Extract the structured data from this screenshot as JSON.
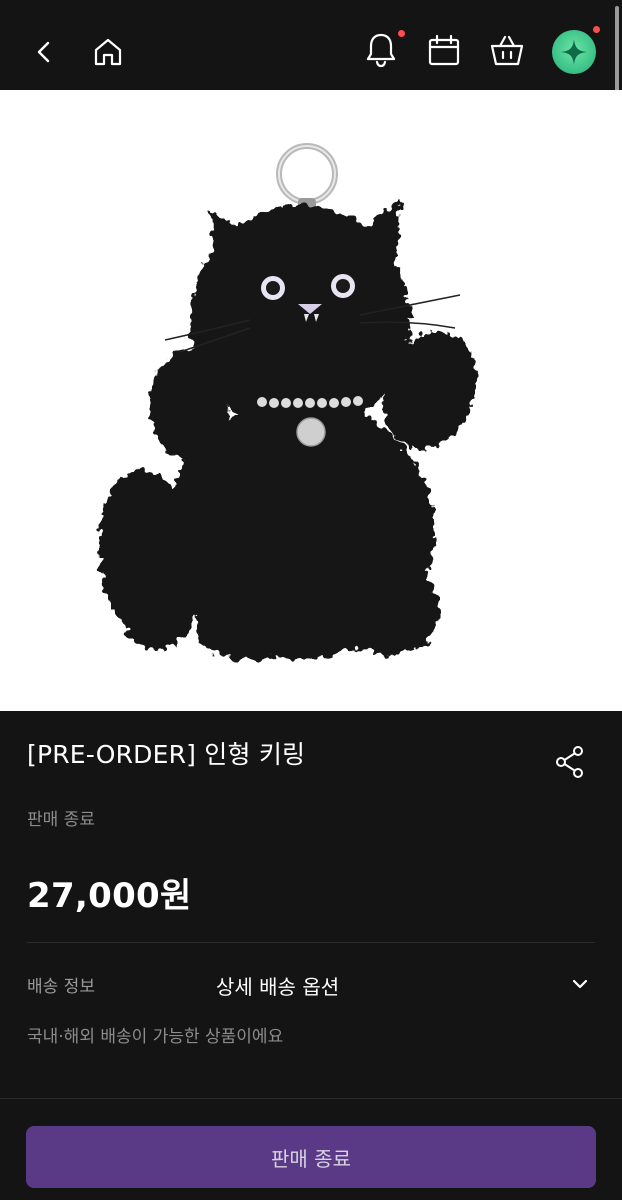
{
  "header": {
    "icons": {
      "back": "chevron-left-icon",
      "home": "home-icon",
      "notifications": "bell-icon",
      "calendar": "calendar-icon",
      "cart": "shopping-basket-icon",
      "profile": "sparkle-avatar-icon"
    },
    "notification_badge": true,
    "profile_badge": true
  },
  "product": {
    "image_subject": "black fuzzy cat plush keyring with silver ring and pearl collar",
    "title": "[PRE-ORDER] 인형 키링",
    "status": "판매 종료",
    "price": "27,000원"
  },
  "shipping": {
    "label": "배송 정보",
    "select_value": "상세 배송 옵션",
    "note": "국내·해외 배송이 가능한 상품이에요"
  },
  "bottom": {
    "button_label": "판매 종료"
  },
  "colors": {
    "background": "#141414",
    "button": "#5a3a86",
    "badge": "#ff4d4d",
    "avatar": "#3fc58a"
  }
}
